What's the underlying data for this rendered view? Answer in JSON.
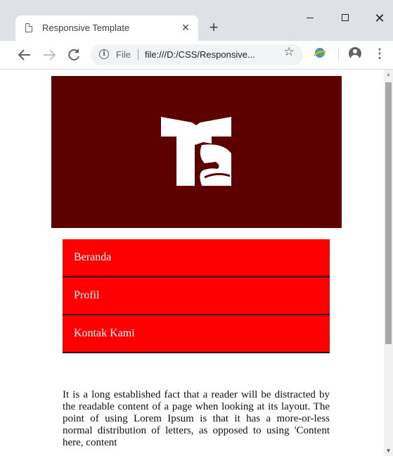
{
  "browser": {
    "tab_title": "Responsive Template",
    "tab_close": "×",
    "new_tab": "+",
    "omnibox_scheme": "File",
    "omnibox_url": "file:///D:/CSS/Responsive...",
    "icons": [
      "file-icon",
      "close-icon",
      "plus-icon",
      "minimize-icon",
      "maximize-icon",
      "window-close-icon",
      "back-arrow-icon",
      "forward-arrow-icon",
      "reload-icon",
      "info-icon",
      "star-icon",
      "extension-icon",
      "profile-icon",
      "menu-icon"
    ],
    "window_close": "✕"
  },
  "page": {
    "header_color": "#5c0000",
    "nav_color": "#ff0000",
    "nav": [
      {
        "label": "Beranda"
      },
      {
        "label": "Profil"
      },
      {
        "label": "Kontak Kami"
      }
    ],
    "body_text": "It is a long established fact that a reader will be distracted by the readable content of a page when looking at its layout. The point of using Lorem Ipsum is that it has a more-or-less normal distribution of letters, as opposed to using 'Content here, content"
  }
}
